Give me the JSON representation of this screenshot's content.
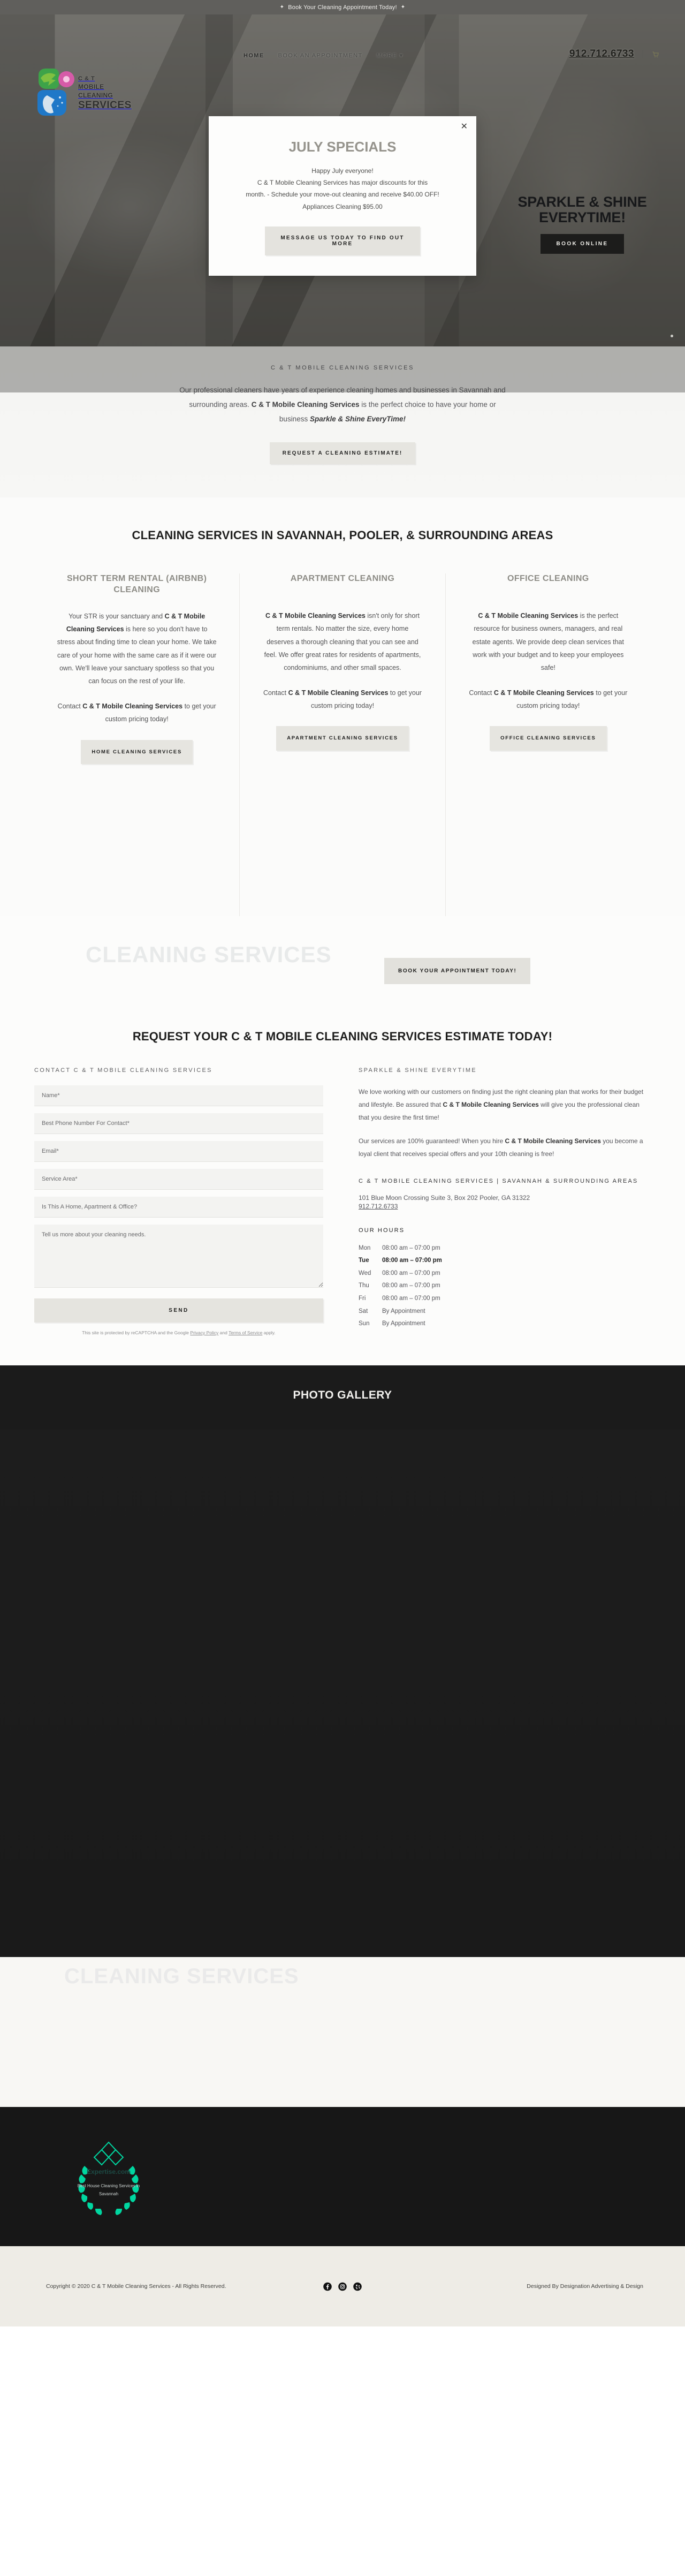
{
  "announce": {
    "text": "Book Your Cleaning Appointment Today!",
    "sparkle_left": "sparkle-icon",
    "sparkle_right": "sparkle-icon"
  },
  "header": {
    "logo": {
      "line1": "C & T",
      "line2": "MOBILE CLEANING",
      "line3": "SERVICES"
    },
    "nav": [
      {
        "label": "HOME"
      },
      {
        "label": "BOOK AN APPOINTMENT"
      },
      {
        "label": "MORE"
      }
    ],
    "more_caret": "chevron-down-icon",
    "phone": "912.712.6733",
    "separator": "|",
    "cart": "cart-icon"
  },
  "hero": {
    "claim_line1": "SPARKLE & SHINE",
    "claim_line2": "EVERYTIME!",
    "book_online_label": "BOOK ONLINE"
  },
  "modal": {
    "close": "close-icon",
    "title": "JULY SPECIALS",
    "body_line1": "Happy July everyone!",
    "body_line2": "C & T Mobile Cleaning Services has major discounts for this",
    "body_line3": "month. - Schedule your move-out cleaning and receive $40.00 OFF!",
    "body_line4": "Appliances Cleaning $95.00",
    "cta_label": "MESSAGE US TODAY TO FIND OUT MORE"
  },
  "intro": {
    "eyebrow": "C & T MOBILE CLEANING SERVICES",
    "text_part1": "Our professional cleaners have years of experience cleaning homes and businesses in Savannah and surrounding areas. ",
    "text_bold1": "C & T Mobile Cleaning Services",
    "text_part2": " is the perfect choice to have your home or business ",
    "text_italic": "Sparkle & Shine EveryTime!",
    "cta_label": "REQUEST A CLEANING ESTIMATE!"
  },
  "services": {
    "heading": "CLEANING SERVICES IN SAVANNAH, POOLER, & SURROUNDING AREAS",
    "columns": [
      {
        "title": "SHORT TERM RENTAL (AIRBNB) CLEANING",
        "p1_a": "Your STR is your sanctuary and ",
        "p1_b": "C & T Mobile Cleaning Services",
        "p1_c": " is here so you don't have to stress about finding time to clean your home.  We take care of your home with the same care as if it were our own.  We'll leave your sanctuary spotless so that you can focus on the rest of your life.",
        "p2_a": "Contact ",
        "p2_b": "C & T Mobile Cleaning Services",
        "p2_c": " to get your custom pricing today!",
        "button": "HOME CLEANING SERVICES"
      },
      {
        "title": "APARTMENT CLEANING",
        "p1_a": "",
        "p1_b": "C & T Mobile Cleaning Services",
        "p1_c": " isn't only for short term rentals.  No matter the size, every home deserves a thorough cleaning that you can see and feel.  We offer great rates for residents of apartments, condominiums, and other small spaces.",
        "p2_a": "Contact ",
        "p2_b": "C & T Mobile Cleaning Services",
        "p2_c": " to get your custom pricing today!",
        "button": "APARTMENT CLEANING SERVICES"
      },
      {
        "title": "OFFICE CLEANING",
        "p1_a": "",
        "p1_b": "C & T Mobile Cleaning Services",
        "p1_c": " is the perfect resource for business owners, managers, and real estate agents.  We provide deep clean services that work with your budget and to keep your employees safe!",
        "p2_a": "Contact ",
        "p2_b": "C & T Mobile Cleaning Services",
        "p2_c": " to get your custom pricing today!",
        "button": "OFFICE CLEANING SERVICES"
      }
    ]
  },
  "book_band": {
    "ghost_text": "CLEANING SERVICES",
    "button": "BOOK YOUR APPOINTMENT TODAY!"
  },
  "estimate": {
    "heading": "REQUEST YOUR C & T MOBILE CLEANING SERVICES ESTIMATE TODAY!",
    "left_title": "CONTACT C & T MOBILE CLEANING SERVICES",
    "right_title": "SPARKLE & SHINE EVERYTIME",
    "fields": [
      {
        "placeholder": "Name*",
        "value": ""
      },
      {
        "placeholder": "Best Phone Number For Contact*",
        "value": ""
      },
      {
        "placeholder": "Email*",
        "value": ""
      },
      {
        "placeholder": "Service Area*",
        "value": ""
      },
      {
        "placeholder": "Is This A Home, Apartment & Office?",
        "value": ""
      }
    ],
    "textarea": {
      "placeholder": "Tell us more about your cleaning needs.",
      "value": ""
    },
    "send_label": "SEND",
    "recaptcha_note_a": "This site is protected by reCAPTCHA and the Google ",
    "recaptcha_privacy": "Privacy Policy",
    "recaptcha_note_b": " and ",
    "recaptcha_terms": "Terms of Service",
    "recaptcha_note_c": " apply.",
    "right_p1_a": "We love working with our customers on finding just the right cleaning plan that works for their budget and lifestyle.  Be assured that ",
    "right_p1_b": "C & T Mobile Cleaning Services",
    "right_p1_c": " will give you the professional clean that you desire the first time!",
    "right_p2_a": "Our services are 100% guaranteed! When you hire ",
    "right_p2_b": "C & T Mobile Cleaning Services",
    "right_p2_c": " you become a loyal client that receives special offers and your 10th cleaning is free!",
    "address_title": "C & T MOBILE CLEANING SERVICES | SAVANNAH & SURROUNDING AREAS",
    "address": "101 Blue Moon Crossing Suite 3, Box 202 Pooler, GA 31322",
    "phone": "912.712.6733",
    "hours_title": "OUR HOURS",
    "hours": [
      {
        "day": "Mon",
        "time": "08:00 am – 07:00 pm",
        "today": false
      },
      {
        "day": "Tue",
        "time": "08:00 am – 07:00 pm",
        "today": true
      },
      {
        "day": "Wed",
        "time": "08:00 am – 07:00 pm",
        "today": false
      },
      {
        "day": "Thu",
        "time": "08:00 am – 07:00 pm",
        "today": false
      },
      {
        "day": "Fri",
        "time": "08:00 am – 07:00 pm",
        "today": false
      },
      {
        "day": "Sat",
        "time": "By Appointment",
        "today": false
      },
      {
        "day": "Sun",
        "time": "By Appointment",
        "today": false
      }
    ]
  },
  "gallery": {
    "heading": "PHOTO GALLERY"
  },
  "lower_band": {
    "ghost_text": "CLEANING SERVICES"
  },
  "footer": {
    "badge_site": "Expertise.com",
    "badge_text": "Best House Cleaning Services in Savannah",
    "copyright": "Copyright © 2020 C & T Mobile Cleaning Services - All Rights Reserved.",
    "credit": "Designed By Designation Advertising & Design",
    "social": [
      {
        "name": "facebook-icon"
      },
      {
        "name": "instagram-icon"
      },
      {
        "name": "yelp-icon"
      }
    ]
  },
  "colors": {
    "accent_dark": "#1c1c1b",
    "button_bg": "#e5e4df",
    "muted_title": "#8d8c86",
    "gallery_bg": "#1b1b1b",
    "footer_bg": "#171717",
    "footer_bottom_bg": "#eeece6",
    "badge_green": "#00d6a0"
  }
}
